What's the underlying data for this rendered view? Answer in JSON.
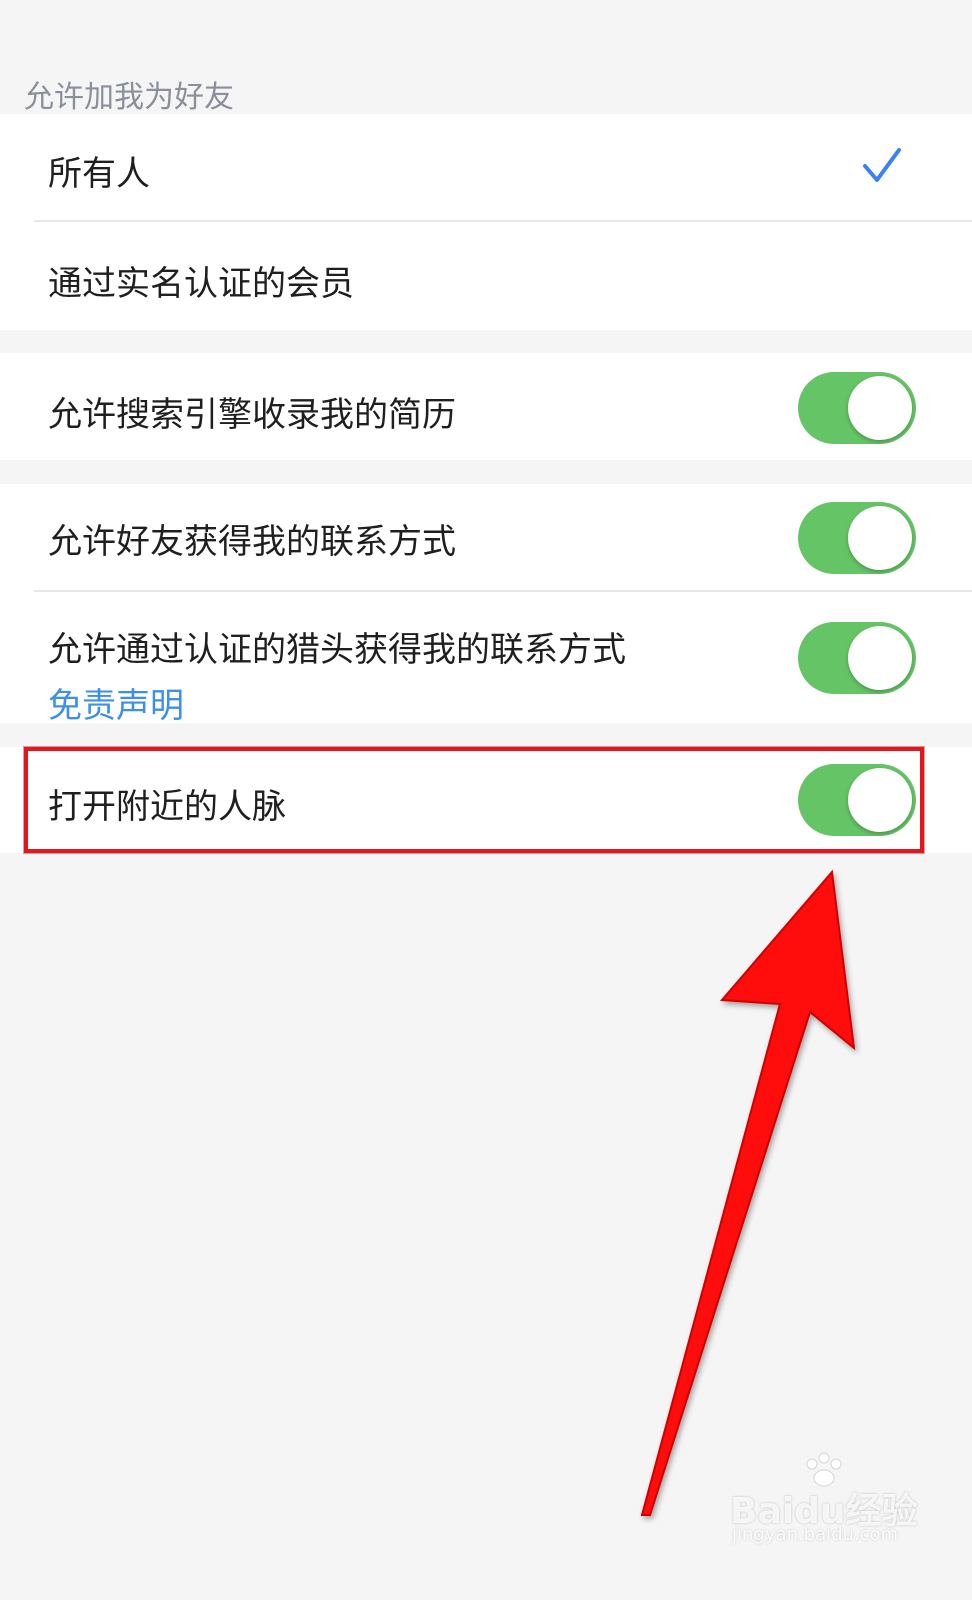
{
  "section_header": "允许加我为好友",
  "friend_options": [
    {
      "label": "所有人",
      "selected": true
    },
    {
      "label": "通过实名认证的会员",
      "selected": false
    }
  ],
  "search_engine": {
    "label": "允许搜索引擎收录我的简历",
    "on": true
  },
  "contact": {
    "friends": {
      "label": "允许好友获得我的联系方式",
      "on": true
    },
    "headhunters": {
      "label": "允许通过认证的猎头获得我的联系方式",
      "on": true,
      "link": "免责声明"
    }
  },
  "nearby": {
    "label": "打开附近的人脉",
    "on": true
  },
  "colors": {
    "toggle_on": "#65c466",
    "check": "#3a82f0",
    "link": "#3d8fe8",
    "highlight": "#e4161b"
  },
  "watermark": {
    "brand": "Baidu经验",
    "url": "jingyan.baidu.com"
  }
}
